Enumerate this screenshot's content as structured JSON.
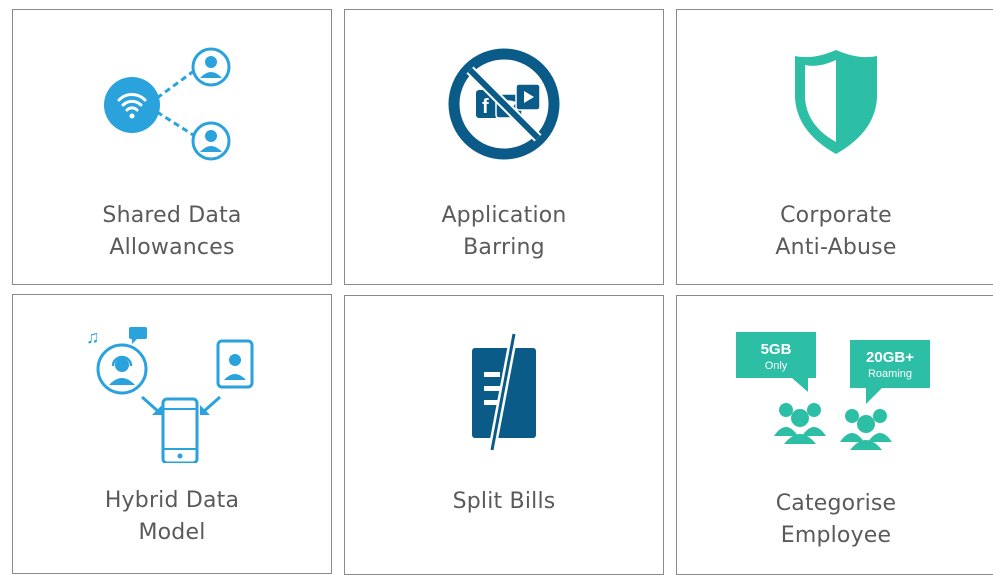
{
  "cards": [
    {
      "line1": "Shared Data",
      "line2": "Allowances",
      "icon": "shared-data-icon"
    },
    {
      "line1": "Application",
      "line2": "Barring",
      "icon": "app-barring-icon"
    },
    {
      "line1": "Corporate",
      "line2": "Anti-Abuse",
      "icon": "shield-icon"
    },
    {
      "line1": "Hybrid Data",
      "line2": "Model",
      "icon": "hybrid-data-icon"
    },
    {
      "line1": "Split Bills",
      "line2": "",
      "icon": "split-bill-icon"
    },
    {
      "line1": "Categorise",
      "line2": "Employee",
      "icon": "employee-groups-icon",
      "bubble1": {
        "big": "5GB",
        "small": "Only"
      },
      "bubble2": {
        "big": "20GB+",
        "small": "Roaming"
      }
    }
  ],
  "colors": {
    "blue": "#2aa2dc",
    "navy": "#0b5b88",
    "teal": "#2dbfa6",
    "text": "#5a5a5a",
    "border": "#8a8a8a"
  }
}
